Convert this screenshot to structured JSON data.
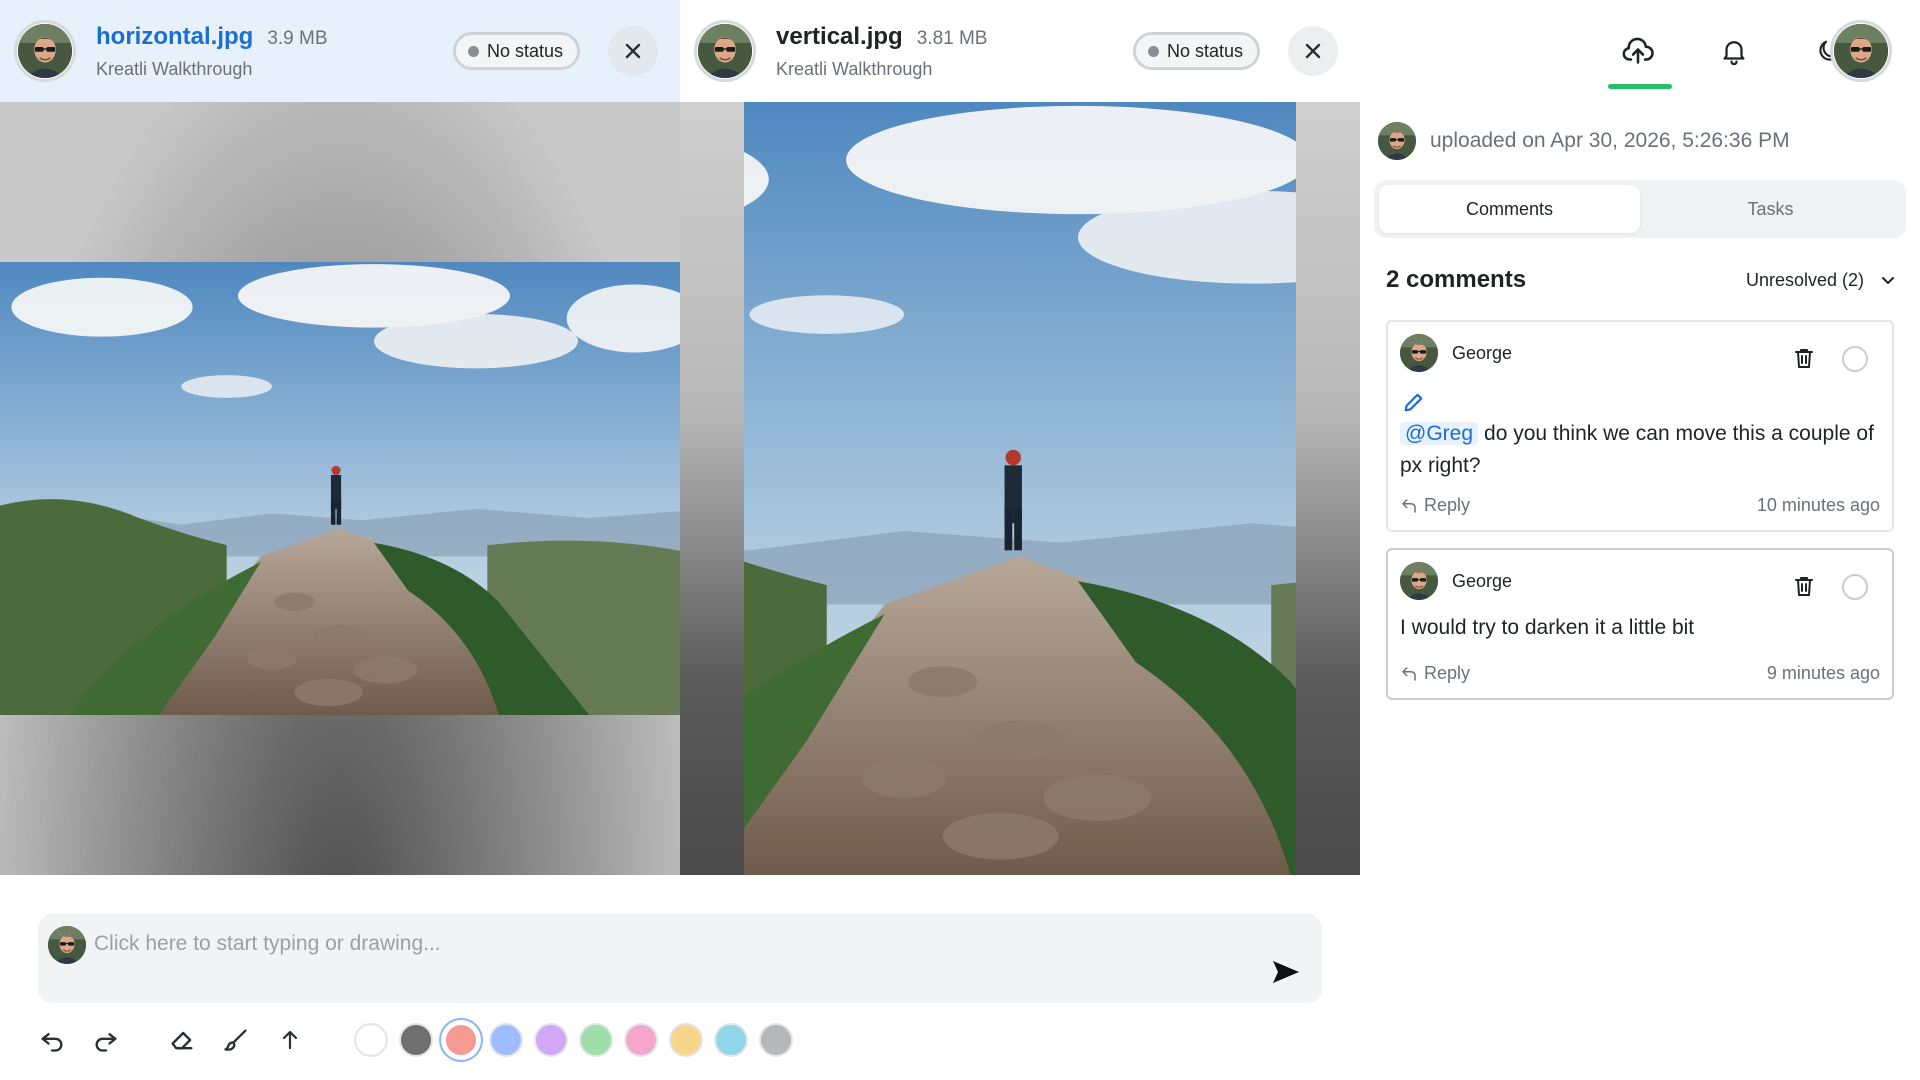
{
  "files": [
    {
      "name": "horizontal.jpg",
      "size": "3.9 MB",
      "project": "Kreatli Walkthrough",
      "status": "No status"
    },
    {
      "name": "vertical.jpg",
      "size": "3.81 MB",
      "project": "Kreatli Walkthrough",
      "status": "No status"
    }
  ],
  "toolbar": {
    "icons": [
      "upload-cloud-icon",
      "bell-icon",
      "moon-icon",
      "avatar"
    ],
    "accent": "#22c067"
  },
  "composer": {
    "placeholder": "Click here to start typing or drawing...",
    "colors": [
      "#ffffff",
      "#6f6f6f",
      "#f59a93",
      "#9ebcff",
      "#d3a7f7",
      "#9fdfaa",
      "#f7a6cb",
      "#f7d58a",
      "#8fd6ea",
      "#b6b8bb"
    ],
    "selected_color_index": 2
  },
  "panel": {
    "upload_text": "uploaded on Apr 30, 2026, 5:26:36 PM",
    "tabs": [
      {
        "label": "Comments"
      },
      {
        "label": "Tasks"
      }
    ],
    "active_tab": 0,
    "comments_count": "2 comments",
    "filter": "Unresolved (2)",
    "comments": [
      {
        "author": "George",
        "mention": "@Greg",
        "text": "do you think we can move this a couple of px right?",
        "reply": "Reply",
        "time": "10 minutes ago",
        "has_drawing": true
      },
      {
        "author": "George",
        "mention": "",
        "text": "I would try to darken it a little bit",
        "reply": "Reply",
        "time": "9 minutes ago",
        "has_drawing": false
      }
    ]
  },
  "colors": {
    "link": "#1a6fd1",
    "header_highlight": "#e7f1fb"
  }
}
